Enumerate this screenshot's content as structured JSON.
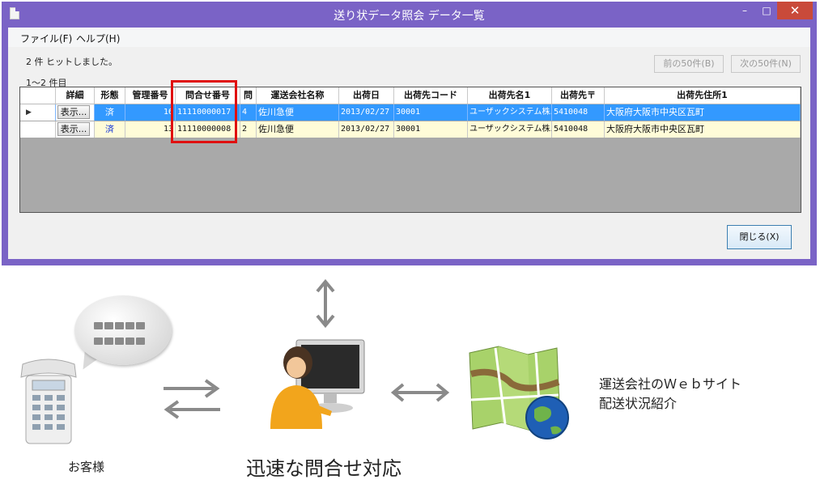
{
  "window": {
    "title": "送り状データ照会 データ一覧",
    "min_label": "–",
    "max_label": "□",
    "close_label": "✕"
  },
  "menu": {
    "file": "ファイル(F)",
    "help": "ヘルプ(H)"
  },
  "status": {
    "hits": "2 件 ヒットしました。",
    "range": "1〜2 件目"
  },
  "pagination": {
    "prev": "前の50件(B)",
    "next": "次の50件(N)"
  },
  "grid": {
    "headers": [
      "詳細",
      "形態",
      "管理番号",
      "問合せ番号",
      "問",
      "運送会社名称",
      "出荷日",
      "出荷先コード",
      "出荷先名1",
      "出荷先〒",
      "出荷先住所1"
    ],
    "rows": [
      {
        "detail": "表示...",
        "form": "済",
        "mgmt": "16",
        "inquiry": "11110000017",
        "q": "4",
        "carrier": "佐川急便",
        "date": "2013/02/27",
        "code": "30001",
        "name1": "ユーザックシステム株...",
        "zip": "5410048",
        "addr1": "大阪府大阪市中央区瓦町"
      },
      {
        "detail": "表示...",
        "form": "済",
        "mgmt": "13",
        "inquiry": "11110000008",
        "q": "2",
        "carrier": "佐川急便",
        "date": "2013/02/27",
        "code": "30001",
        "name1": "ユーザックシステム株...",
        "zip": "5410048",
        "addr1": "大阪府大阪市中央区瓦町"
      }
    ],
    "current_row_marker": "▶"
  },
  "close_button": "閉じる(X)",
  "illustration": {
    "customer_label": "お客様",
    "center_label": "迅速な問合せ対応",
    "carrier_site_line1": "運送会社のＷｅｂサイト",
    "carrier_site_line2": "配送状況紹介"
  },
  "colors": {
    "window_frame": "#7a63c6",
    "selected_row": "#3399ff",
    "second_row": "#fffcd8",
    "highlight": "#e01010",
    "close_button": "#c94a3a"
  }
}
